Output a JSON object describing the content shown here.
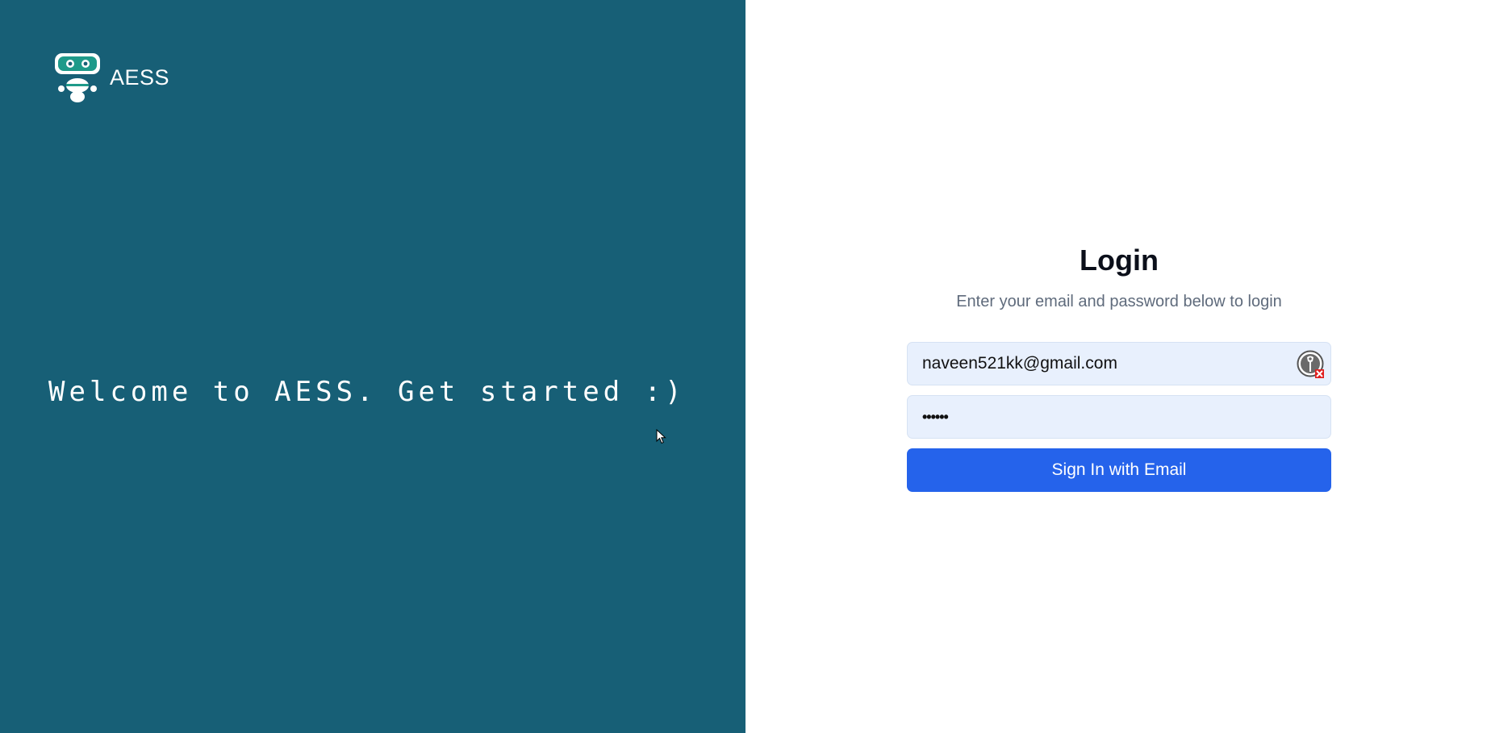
{
  "brand": {
    "name": "AESS",
    "logo_icon": "robot-icon"
  },
  "hero": {
    "welcome_text": "Welcome to AESS. Get started :)"
  },
  "login": {
    "title": "Login",
    "subtitle": "Enter your email and password below to login",
    "email_value": "naveen521kk@gmail.com",
    "password_mask": "••••••",
    "password_manager_icon": "password-manager-icon",
    "signin_label": "Sign In with Email"
  },
  "colors": {
    "left_panel_bg": "#175f76",
    "button_bg": "#2563eb",
    "input_bg": "#e8f0fd",
    "logo_accent": "#1e9a8a"
  }
}
